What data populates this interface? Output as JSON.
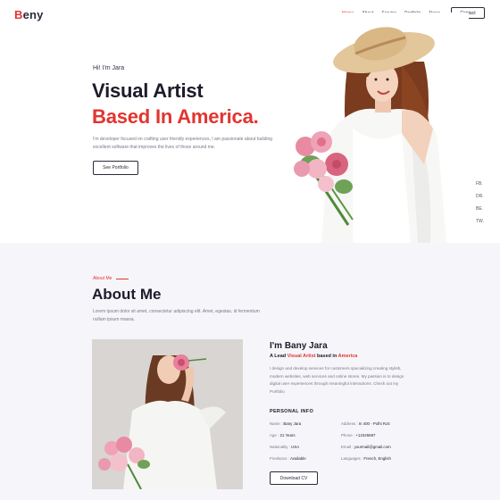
{
  "header": {
    "logo_accent": "B",
    "logo_rest": "eny",
    "nav": [
      {
        "label": "Home",
        "active": true
      },
      {
        "label": "About",
        "active": false
      },
      {
        "label": "Service",
        "active": false
      },
      {
        "label": "Portfolio",
        "active": false
      },
      {
        "label": "News",
        "active": false
      }
    ],
    "contact_label": "Contact"
  },
  "hero": {
    "greeting": "Hi! I'm Jara",
    "title_line1": "Visual Artist",
    "title_line2": "Based In America.",
    "description": "I'm developer focused on crafting user friendly experiences, I am passionate about building excellent software that improves the lives of those around me.",
    "portfolio_label": "See Portfolio",
    "social": [
      "FB.",
      "DR.",
      "BE.",
      "TW."
    ]
  },
  "about": {
    "kicker": "About Me",
    "title": "About Me",
    "subtitle": "Lorem ipsum dolor sit amet, consectetur adipiscing elit. Amet, egestas, id fermentum nullam ipsum massa.",
    "name": "I'm Bany Jara",
    "role_prefix": "A Lead ",
    "role_highlight1": "Visual Artist",
    "role_middle": " based in ",
    "role_highlight2": "America",
    "bio": "I design and develop services for customers specializing creating stylish, modern websites, web services and online stores. My passion is to design digital user experiences through meaningful interactions. Check out my Portfolio",
    "info_title": "PERSONAL INFO",
    "info": [
      {
        "label": "Name : ",
        "value": "Bany Jara"
      },
      {
        "label": "Address : ",
        "value": "In 400 - Polhi RJ4"
      },
      {
        "label": "Age : ",
        "value": "21 Years"
      },
      {
        "label": "Phone : ",
        "value": "+12345697"
      },
      {
        "label": "Nationality : ",
        "value": "USA"
      },
      {
        "label": "Email : ",
        "value": "yourmail@gmail.com"
      },
      {
        "label": "Freelance : ",
        "value": "Available"
      },
      {
        "label": "Languages : ",
        "value": "French, English"
      }
    ],
    "download_label": "Download CV"
  },
  "colors": {
    "accent": "#e3342f",
    "text_dark": "#1c1c2b",
    "text_muted": "#777788",
    "about_bg": "#f6f6fa"
  }
}
